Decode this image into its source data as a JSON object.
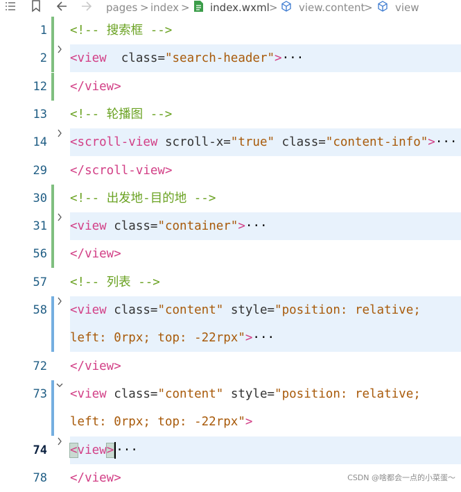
{
  "breadcrumb": {
    "pages": "pages",
    "index_folder": "index",
    "file": "index.wxml",
    "node1": "view.content",
    "node2": "view",
    "sep": ">"
  },
  "lines": [
    {
      "n": "1",
      "folded": false,
      "tokens": [
        {
          "c": "cmt",
          "t": "<!-- "
        },
        {
          "c": "cmt",
          "t": "搜索框"
        },
        {
          "c": "cmt",
          "t": " -->"
        }
      ]
    },
    {
      "n": "2",
      "folded": true,
      "tokens": [
        {
          "c": "tag",
          "t": "<view"
        },
        {
          "c": "attr",
          "t": "  class="
        },
        {
          "c": "str",
          "t": "\"search-header\""
        },
        {
          "c": "tag",
          "t": ">"
        },
        {
          "c": "ell",
          "t": "···"
        }
      ]
    },
    {
      "n": "12",
      "folded": false,
      "tokens": [
        {
          "c": "tag",
          "t": "</view>"
        }
      ]
    },
    {
      "n": "13",
      "folded": false,
      "tokens": [
        {
          "c": "cmt",
          "t": "<!-- "
        },
        {
          "c": "cmt",
          "t": "轮播图"
        },
        {
          "c": "cmt",
          "t": " -->"
        }
      ]
    },
    {
      "n": "14",
      "folded": true,
      "tokens": [
        {
          "c": "tag",
          "t": "<scroll-view"
        },
        {
          "c": "attr",
          "t": " scroll-x="
        },
        {
          "c": "str",
          "t": "\"true\""
        },
        {
          "c": "attr",
          "t": " class="
        },
        {
          "c": "str",
          "t": "\"content-info\""
        },
        {
          "c": "tag",
          "t": ">"
        },
        {
          "c": "ell",
          "t": "···"
        }
      ]
    },
    {
      "n": "29",
      "folded": false,
      "tokens": [
        {
          "c": "tag",
          "t": "</scroll-view>"
        }
      ]
    },
    {
      "n": "30",
      "folded": false,
      "tokens": [
        {
          "c": "cmt",
          "t": "<!-- "
        },
        {
          "c": "cmt",
          "t": "出发地-目的地"
        },
        {
          "c": "cmt",
          "t": " -->"
        }
      ]
    },
    {
      "n": "31",
      "folded": true,
      "tokens": [
        {
          "c": "tag",
          "t": "<view"
        },
        {
          "c": "attr",
          "t": " class="
        },
        {
          "c": "str",
          "t": "\"container\""
        },
        {
          "c": "tag",
          "t": ">"
        },
        {
          "c": "ell",
          "t": "···"
        }
      ]
    },
    {
      "n": "56",
      "folded": false,
      "tokens": [
        {
          "c": "tag",
          "t": "</view>"
        }
      ]
    },
    {
      "n": "57",
      "folded": false,
      "tokens": [
        {
          "c": "cmt",
          "t": "<!-- "
        },
        {
          "c": "cmt",
          "t": "列表"
        },
        {
          "c": "cmt",
          "t": " -->"
        }
      ]
    },
    {
      "n": "58",
      "folded": true,
      "tokens": [
        {
          "c": "tag",
          "t": "<view"
        },
        {
          "c": "attr",
          "t": " class="
        },
        {
          "c": "str",
          "t": "\"content\""
        },
        {
          "c": "attr",
          "t": " style="
        },
        {
          "c": "str",
          "t": "\"position: relative;"
        }
      ]
    },
    {
      "n": "",
      "folded": false,
      "tokens": [
        {
          "c": "str",
          "t": "left: 0rpx; top: -22rpx\""
        },
        {
          "c": "tag",
          "t": ">"
        },
        {
          "c": "ell",
          "t": "···"
        }
      ]
    },
    {
      "n": "72",
      "folded": false,
      "tokens": [
        {
          "c": "tag",
          "t": "</view>"
        }
      ]
    },
    {
      "n": "73",
      "folded": false,
      "expanded": true,
      "tokens": [
        {
          "c": "tag",
          "t": "<view"
        },
        {
          "c": "attr",
          "t": " class="
        },
        {
          "c": "str",
          "t": "\"content\""
        },
        {
          "c": "attr",
          "t": " style="
        },
        {
          "c": "str",
          "t": "\"position: relative;"
        }
      ]
    },
    {
      "n": "",
      "folded": false,
      "tokens": [
        {
          "c": "str",
          "t": "left: 0rpx; top: -22rpx\""
        },
        {
          "c": "tag",
          "t": ">"
        }
      ]
    },
    {
      "n": "74",
      "folded": true,
      "current": true,
      "tokens": [
        {
          "c": "brk",
          "t": "<"
        },
        {
          "c": "tag",
          "t": "view"
        },
        {
          "c": "brk",
          "t": ">"
        },
        {
          "c": "caret",
          "t": ""
        },
        {
          "c": "ell",
          "t": "···"
        }
      ]
    },
    {
      "n": "78",
      "folded": false,
      "tokens": [
        {
          "c": "tag",
          "t": "</view>"
        }
      ]
    }
  ],
  "watermark": "CSDN @啥都会一点的小菜蛋～"
}
